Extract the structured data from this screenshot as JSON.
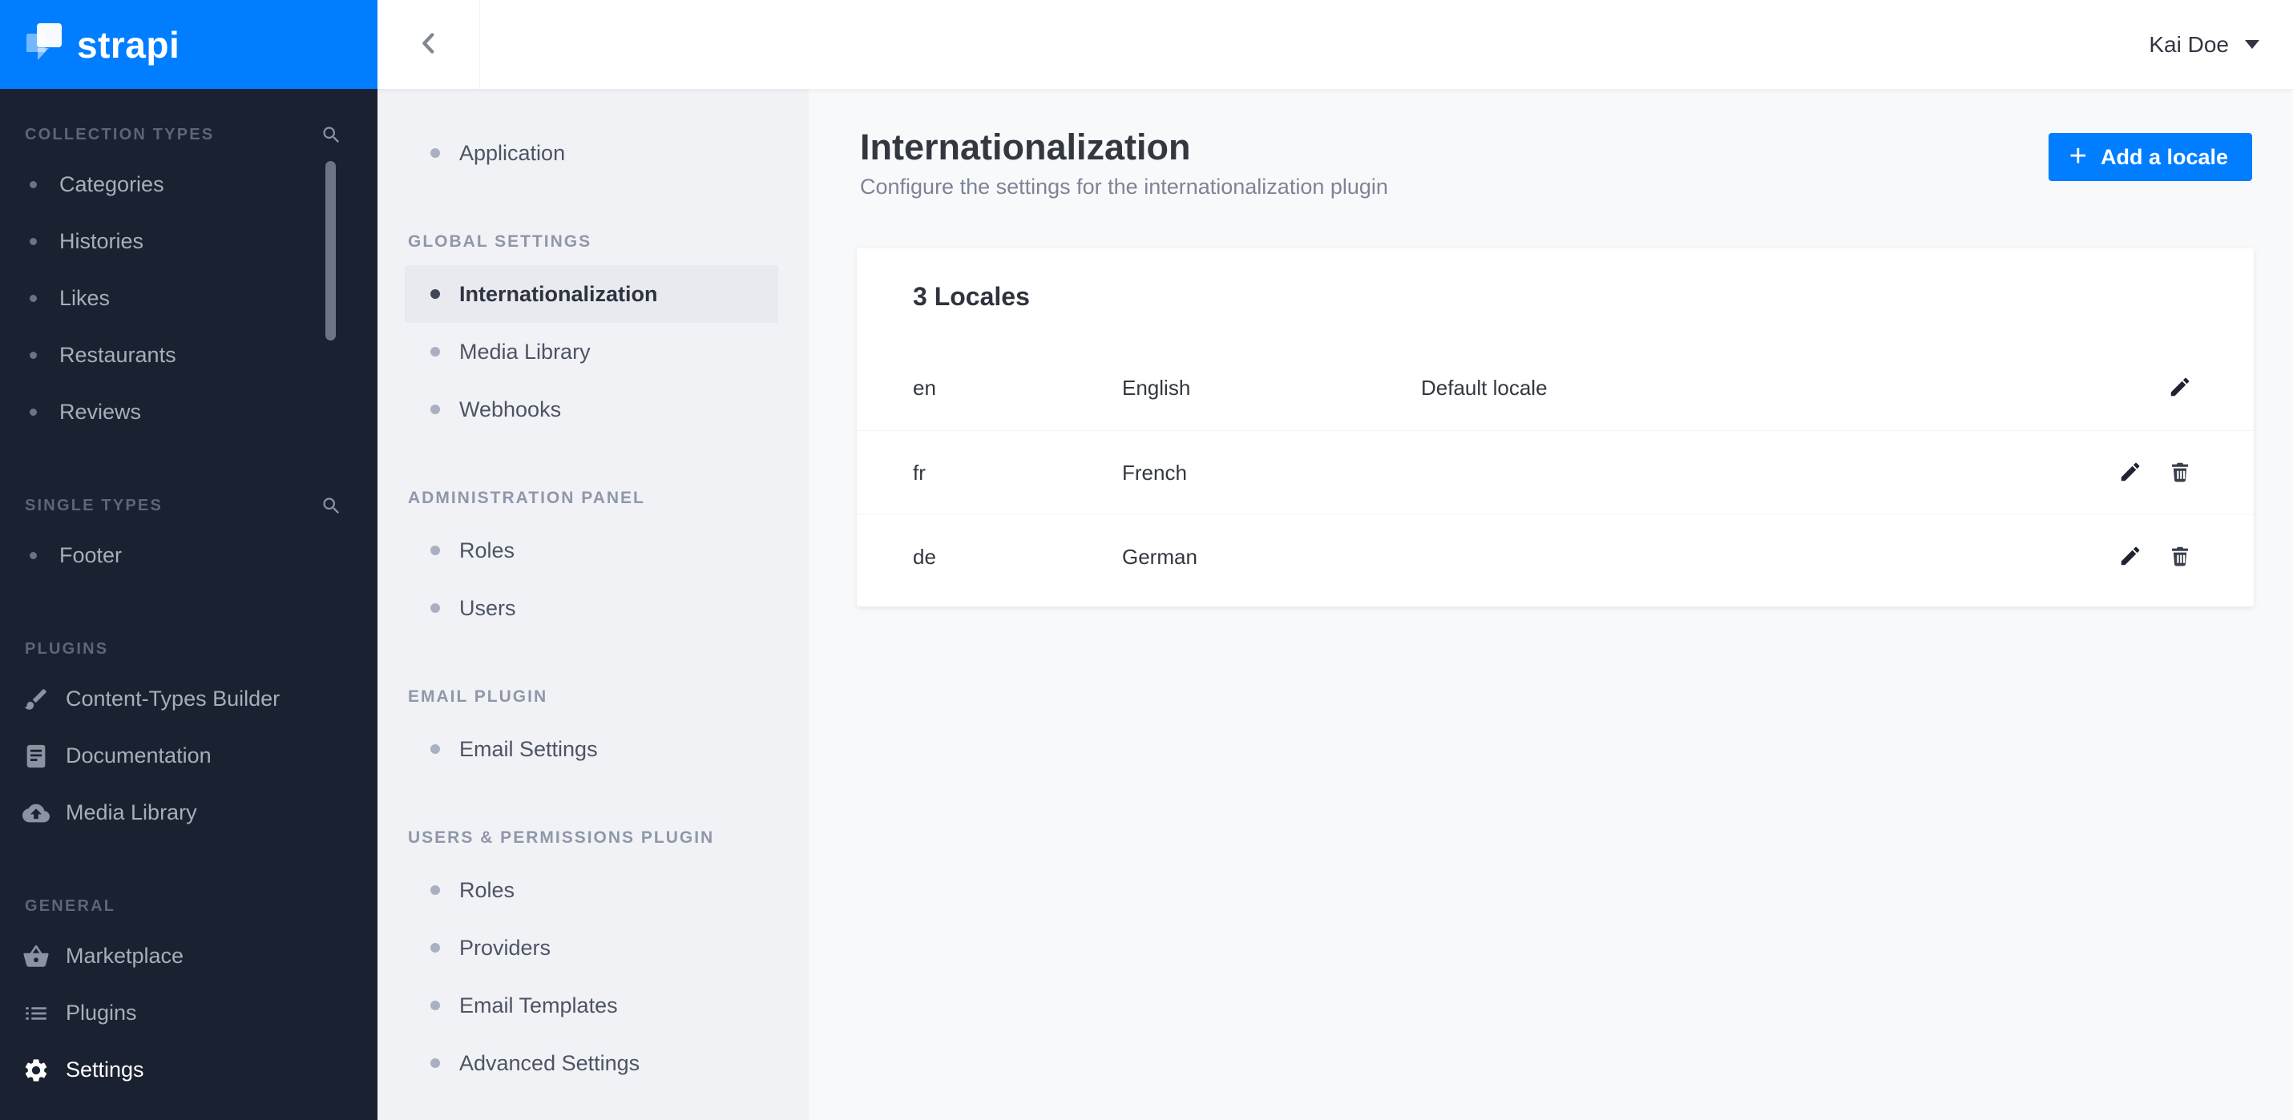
{
  "brand": {
    "name": "strapi"
  },
  "topbar": {
    "user_name": "Kai Doe"
  },
  "main_sidebar": {
    "sections": [
      {
        "label": "COLLECTION TYPES",
        "search": true,
        "items": [
          {
            "label": "Categories"
          },
          {
            "label": "Histories"
          },
          {
            "label": "Likes"
          },
          {
            "label": "Restaurants"
          },
          {
            "label": "Reviews"
          }
        ]
      },
      {
        "label": "SINGLE TYPES",
        "search": true,
        "items": [
          {
            "label": "Footer"
          }
        ]
      },
      {
        "label": "PLUGINS",
        "items": [
          {
            "label": "Content-Types Builder",
            "icon": "paintbrush-icon"
          },
          {
            "label": "Documentation",
            "icon": "book-icon"
          },
          {
            "label": "Media Library",
            "icon": "cloud-upload-icon"
          }
        ]
      },
      {
        "label": "GENERAL",
        "items": [
          {
            "label": "Marketplace",
            "icon": "basket-icon"
          },
          {
            "label": "Plugins",
            "icon": "list-icon"
          },
          {
            "label": "Settings",
            "icon": "gear-icon",
            "active": true
          }
        ]
      }
    ]
  },
  "settings_nav": {
    "top_items": [
      {
        "label": "Application"
      }
    ],
    "sections": [
      {
        "label": "GLOBAL SETTINGS",
        "items": [
          {
            "label": "Internationalization",
            "active": true
          },
          {
            "label": "Media Library"
          },
          {
            "label": "Webhooks"
          }
        ]
      },
      {
        "label": "ADMINISTRATION PANEL",
        "items": [
          {
            "label": "Roles"
          },
          {
            "label": "Users"
          }
        ]
      },
      {
        "label": "EMAIL PLUGIN",
        "items": [
          {
            "label": "Email Settings"
          }
        ]
      },
      {
        "label": "USERS & PERMISSIONS PLUGIN",
        "items": [
          {
            "label": "Roles"
          },
          {
            "label": "Providers"
          },
          {
            "label": "Email Templates"
          },
          {
            "label": "Advanced Settings"
          }
        ]
      }
    ]
  },
  "page": {
    "title": "Internationalization",
    "subtitle": "Configure the settings for the internationalization plugin",
    "add_locale_button": {
      "plus": "+",
      "label": "Add a locale"
    }
  },
  "locales": {
    "heading": "3 Locales",
    "rows": [
      {
        "code": "en",
        "name": "English",
        "note": "Default locale",
        "can_delete": false
      },
      {
        "code": "fr",
        "name": "French",
        "note": "",
        "can_delete": true
      },
      {
        "code": "de",
        "name": "German",
        "note": "",
        "can_delete": true
      }
    ]
  },
  "colors": {
    "accent": "#007eff",
    "sidebar_bg": "#1a2130",
    "subnav_bg": "#f1f2f5",
    "content_bg": "#f8f9fa",
    "active_highlight": "#e9eaef"
  }
}
